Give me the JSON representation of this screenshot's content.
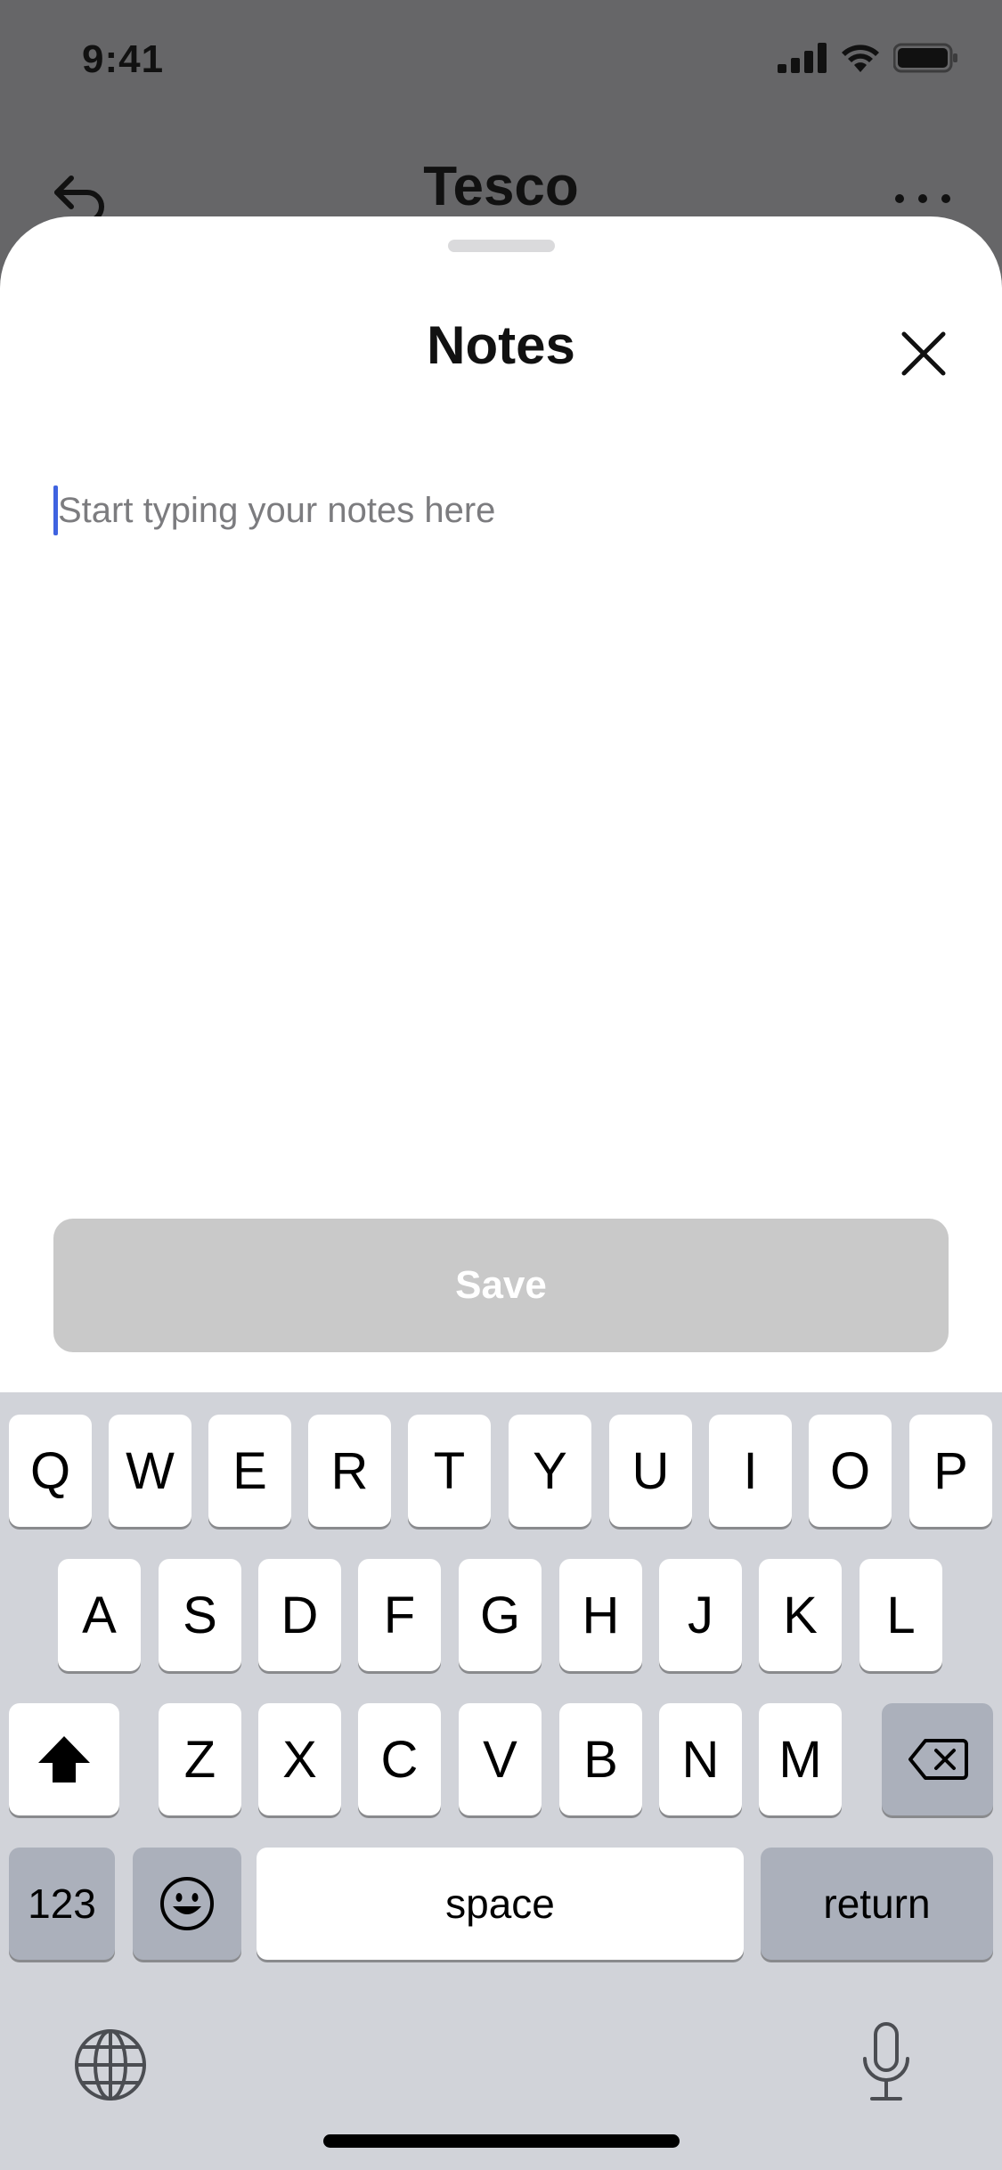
{
  "status_bar": {
    "time": "9:41"
  },
  "app_bar": {
    "title": "Tesco"
  },
  "sheet": {
    "title": "Notes",
    "notes_placeholder": "Start typing your notes here",
    "save_label": "Save"
  },
  "keyboard": {
    "row1": [
      "Q",
      "W",
      "E",
      "R",
      "T",
      "Y",
      "U",
      "I",
      "O",
      "P"
    ],
    "row2": [
      "A",
      "S",
      "D",
      "F",
      "G",
      "H",
      "J",
      "K",
      "L"
    ],
    "row3": [
      "Z",
      "X",
      "C",
      "V",
      "B",
      "N",
      "M"
    ],
    "numbers_label": "123",
    "space_label": "space",
    "return_label": "return"
  },
  "icons": {
    "back": "back-arrow-icon",
    "more": "more-dots-icon",
    "close": "close-icon",
    "shift": "shift-icon",
    "delete": "delete-icon",
    "emoji": "emoji-icon",
    "globe": "globe-icon",
    "mic": "microphone-icon"
  },
  "colors": {
    "caret": "#3f63e0",
    "save_disabled": "#c9c9c9",
    "keyboard_bg": "#d1d3d9"
  }
}
